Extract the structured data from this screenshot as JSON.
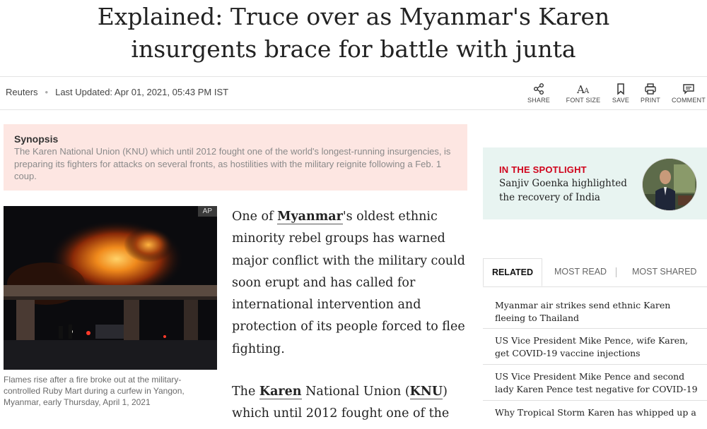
{
  "article": {
    "headline_line1": "Explained: Truce over as Myanmar's Karen",
    "headline_line2": "insurgents brace for battle with junta",
    "source": "Reuters",
    "updated": "Last Updated: Apr 01, 2021, 05:43 PM IST"
  },
  "toolbar": [
    {
      "label": "SHARE",
      "icon": "share-icon"
    },
    {
      "label": "FONT SIZE",
      "icon": "font-size-icon"
    },
    {
      "label": "SAVE",
      "icon": "bookmark-icon"
    },
    {
      "label": "PRINT",
      "icon": "print-icon"
    },
    {
      "label": "COMMENT",
      "icon": "comment-icon"
    }
  ],
  "synopsis": {
    "heading": "Synopsis",
    "text": "The Karen National Union (KNU) which until 2012 fought one of the world's longest-running insurgencies, is preparing its fighters for attacks on several fronts, as hostilities with the military reignite following a Feb. 1 coup."
  },
  "photo": {
    "badge": "AP",
    "caption": "Flames rise after a fire broke out at the military-controlled Ruby Mart during a curfew in Yangon, Myanmar, early Thursday, April 1, 2021"
  },
  "body": {
    "p1_pre": "One of ",
    "p1_link": "Myanmar",
    "p1_post": "'s oldest ethnic minority rebel groups has warned major conflict with the military could soon erupt and has called for international intervention and protection of its people forced to flee fighting.",
    "p2_pre": "The ",
    "p2_link1": "Karen",
    "p2_mid": " National Union (",
    "p2_link2": "KNU",
    "p2_post": ") which until 2012 fought one of the"
  },
  "spotlight": {
    "heading": "IN THE SPOTLIGHT",
    "text": "Sanjiv Goenka highlighted the recovery of India"
  },
  "tabs": {
    "related": "RELATED",
    "most_read": "MOST READ",
    "most_shared": "MOST SHARED"
  },
  "related": [
    "Myanmar air strikes send ethnic Karen fleeing to Thailand",
    "US Vice President Mike Pence, wife Karen, get COVID-19 vaccine injections",
    "US Vice President Mike Pence and second lady Karen Pence test negative for COVID-19",
    "Why Tropical Storm Karen has whipped up a"
  ],
  "colors": {
    "synopsis_bg": "#fde6e2",
    "spotlight_bg": "#e8f4f1",
    "spotlight_heading": "#d0021b"
  }
}
